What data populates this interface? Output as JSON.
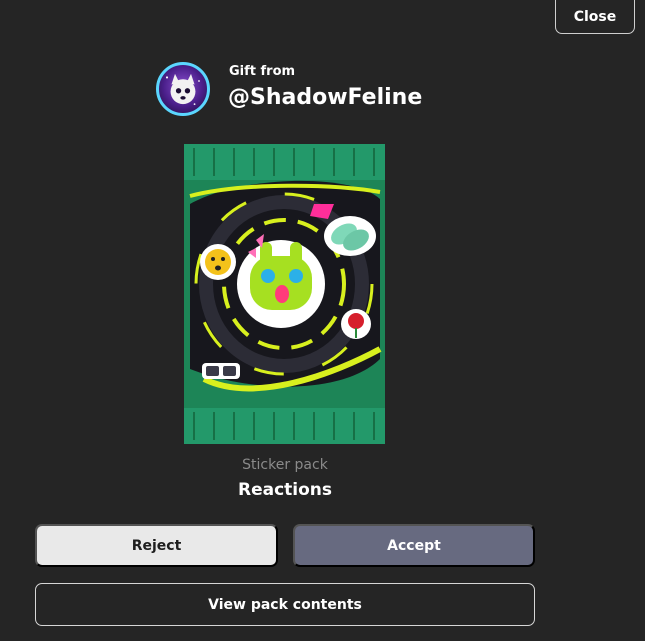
{
  "header": {
    "close_label": "Close"
  },
  "gift": {
    "from_label": "Gift from",
    "sender": "@ShadowFeline",
    "avatar_icon": "cat-avatar-icon"
  },
  "pack": {
    "type": "Sticker pack",
    "name": "Reactions",
    "colors": {
      "wrapper": "#1f8a5a",
      "accent": "#d8f01e",
      "center": "#1a1a22"
    }
  },
  "actions": {
    "reject_label": "Reject",
    "accept_label": "Accept",
    "view_label": "View pack contents"
  }
}
